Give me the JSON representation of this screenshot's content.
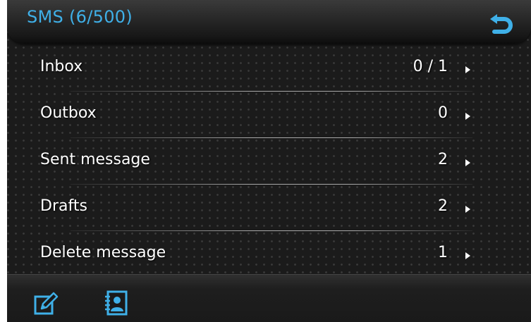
{
  "header": {
    "title": "SMS (6/500)",
    "back_icon": "back-arrow-icon"
  },
  "menu": {
    "items": [
      {
        "label": "Inbox",
        "count": "0 / 1"
      },
      {
        "label": "Outbox",
        "count": "0"
      },
      {
        "label": "Sent message",
        "count": "2"
      },
      {
        "label": "Drafts",
        "count": "2"
      },
      {
        "label": "Delete message",
        "count": "1"
      }
    ]
  },
  "footer": {
    "compose_icon": "compose-icon",
    "contacts_icon": "contacts-icon"
  },
  "colors": {
    "accent": "#3fb0e8",
    "background": "#1b1b1b",
    "text": "#ffffff"
  }
}
